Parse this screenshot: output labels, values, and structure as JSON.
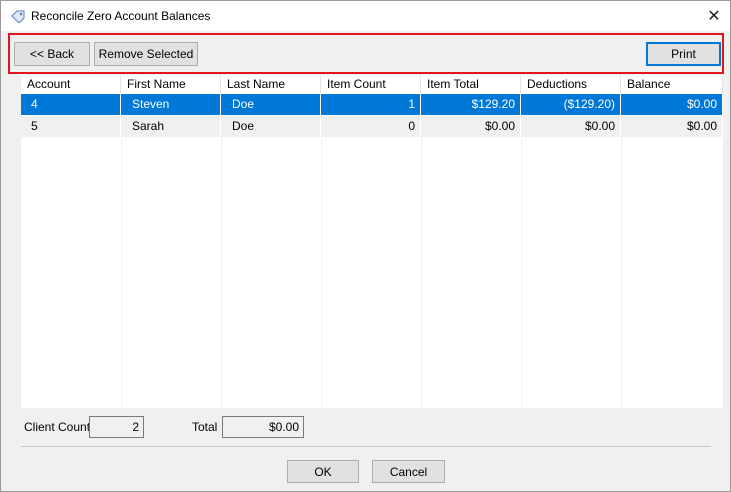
{
  "window": {
    "title": "Reconcile Zero Account Balances",
    "close_glyph": "✕"
  },
  "toolbar": {
    "back_label": "<< Back",
    "remove_label": "Remove Selected",
    "print_label": "Print",
    "highlight_color": "#e0151f"
  },
  "grid": {
    "columns": [
      "Account",
      "First Name",
      "Last Name",
      "Item Count",
      "Item Total",
      "Deductions",
      "Balance"
    ],
    "rows": [
      [
        "4",
        "Steven",
        "Doe",
        "1",
        "$129.20",
        "($129.20)",
        "$0.00"
      ],
      [
        "5",
        "Sarah",
        "Doe",
        "0",
        "$0.00",
        "$0.00",
        "$0.00"
      ]
    ],
    "selected_row": 0,
    "selection_color": "#0078d7"
  },
  "footer": {
    "client_count_label": "Client Count",
    "client_count_value": "2",
    "total_label": "Total",
    "total_value": "$0.00"
  },
  "dialog": {
    "ok_label": "OK",
    "cancel_label": "Cancel"
  },
  "icons": {
    "title_icon": "tag-icon",
    "close_icon": "close-icon"
  }
}
